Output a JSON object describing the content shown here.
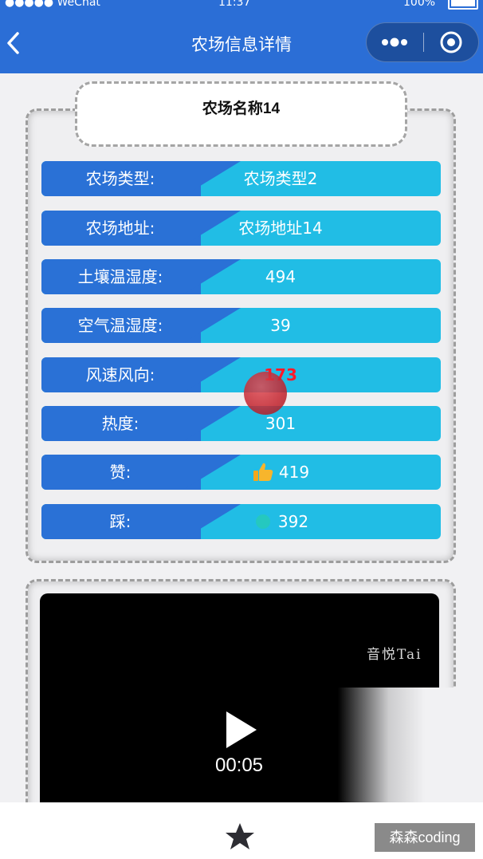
{
  "status_bar": {
    "carrier": "●●●●● WeChat",
    "time": "11:37",
    "battery": "100%"
  },
  "nav": {
    "title": "农场信息详情",
    "back_icon": "chevron-left-icon",
    "more_icon": "more-dots-icon",
    "close_icon": "target-circle-icon"
  },
  "farm": {
    "name": "农场名称14",
    "rows": [
      {
        "label": "农场类型:",
        "value": "农场类型2"
      },
      {
        "label": "农场地址:",
        "value": "农场地址14"
      },
      {
        "label": "土壤温湿度:",
        "value": "494"
      },
      {
        "label": "空气温湿度:",
        "value": "39"
      },
      {
        "label": "风速风向:",
        "value": "173"
      },
      {
        "label": "热度:",
        "value": "301"
      },
      {
        "label": "赞:",
        "value": "419"
      },
      {
        "label": "踩:",
        "value": "392"
      }
    ]
  },
  "video": {
    "watermark": "音悦Tai",
    "time": "00:05",
    "play_icon": "play-icon"
  },
  "bottom": {
    "star_icon": "star-icon",
    "brand": "森森coding"
  },
  "colors": {
    "nav_bg": "#2b6ed6",
    "label_bg": "#2a71d6",
    "value_bg": "#21bde5",
    "highlight_value": "#ff1a2a"
  }
}
